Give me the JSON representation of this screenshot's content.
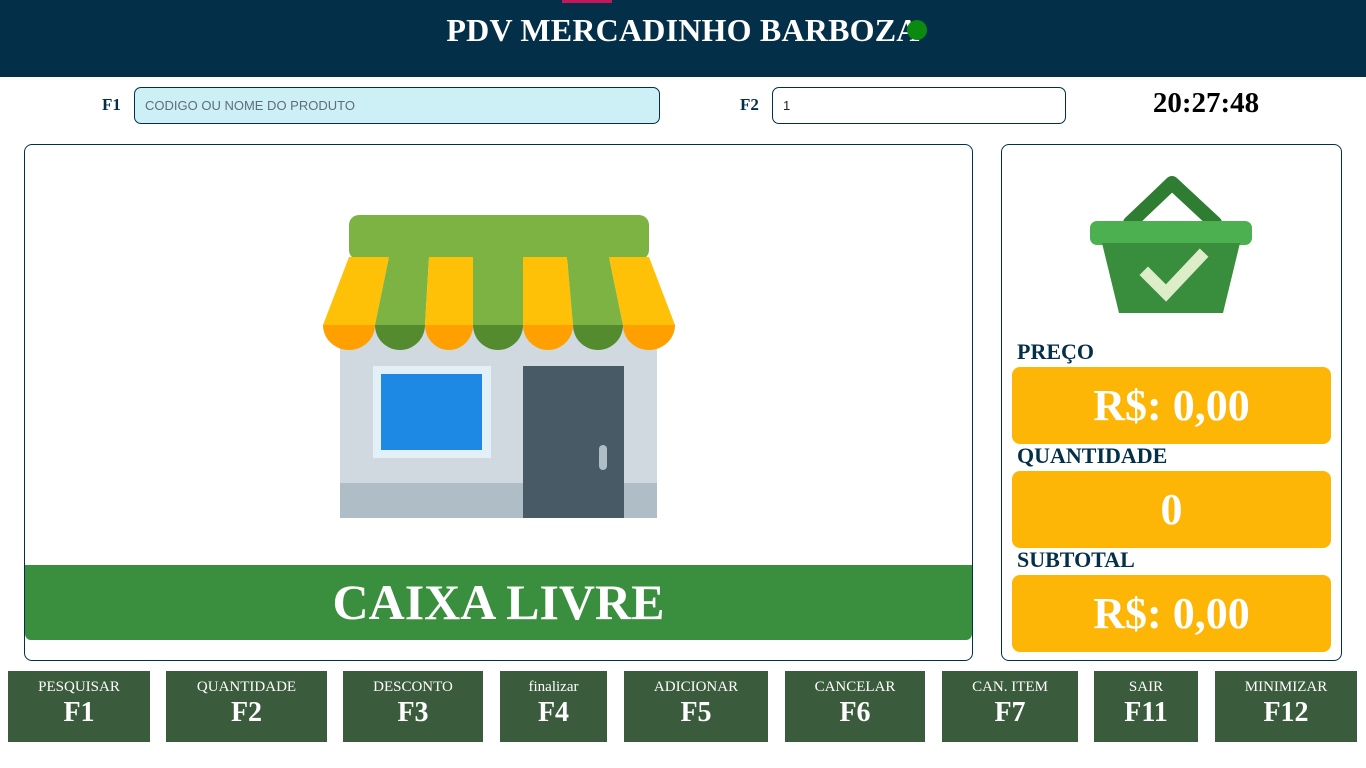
{
  "header": {
    "title": "PDV MERCADINHO BARBOZA",
    "status_color": "#0a8a10"
  },
  "search": {
    "label": "F1",
    "placeholder": "CODIGO OU NOME DO PRODUTO",
    "value": ""
  },
  "quantity_input": {
    "label": "F2",
    "value": "1"
  },
  "clock": "20:27:48",
  "main": {
    "illustration": "store-icon",
    "status_text": "CAIXA LIVRE"
  },
  "side": {
    "icon": "basket-check-icon",
    "price_label": "PREÇO",
    "price_value": "R$: 0,00",
    "quantity_label": "QUANTIDADE",
    "quantity_value": "0",
    "subtotal_label": "SUBTOTAL",
    "subtotal_value": "R$: 0,00"
  },
  "function_keys": [
    {
      "name": "PESQUISAR",
      "key": "F1"
    },
    {
      "name": "QUANTIDADE",
      "key": "F2"
    },
    {
      "name": "DESCONTO",
      "key": "F3"
    },
    {
      "name": "finalizar",
      "key": "F4"
    },
    {
      "name": "ADICIONAR",
      "key": "F5"
    },
    {
      "name": "CANCELAR",
      "key": "F6"
    },
    {
      "name": "CAN. ITEM",
      "key": "F7"
    },
    {
      "name": "SAIR",
      "key": "F11"
    },
    {
      "name": "MINIMIZAR",
      "key": "F12"
    }
  ],
  "colors": {
    "header_bg": "#033048",
    "accent_green": "#3a8f3e",
    "value_box": "#fdb606",
    "fkey_bg": "#3b5b3d"
  }
}
